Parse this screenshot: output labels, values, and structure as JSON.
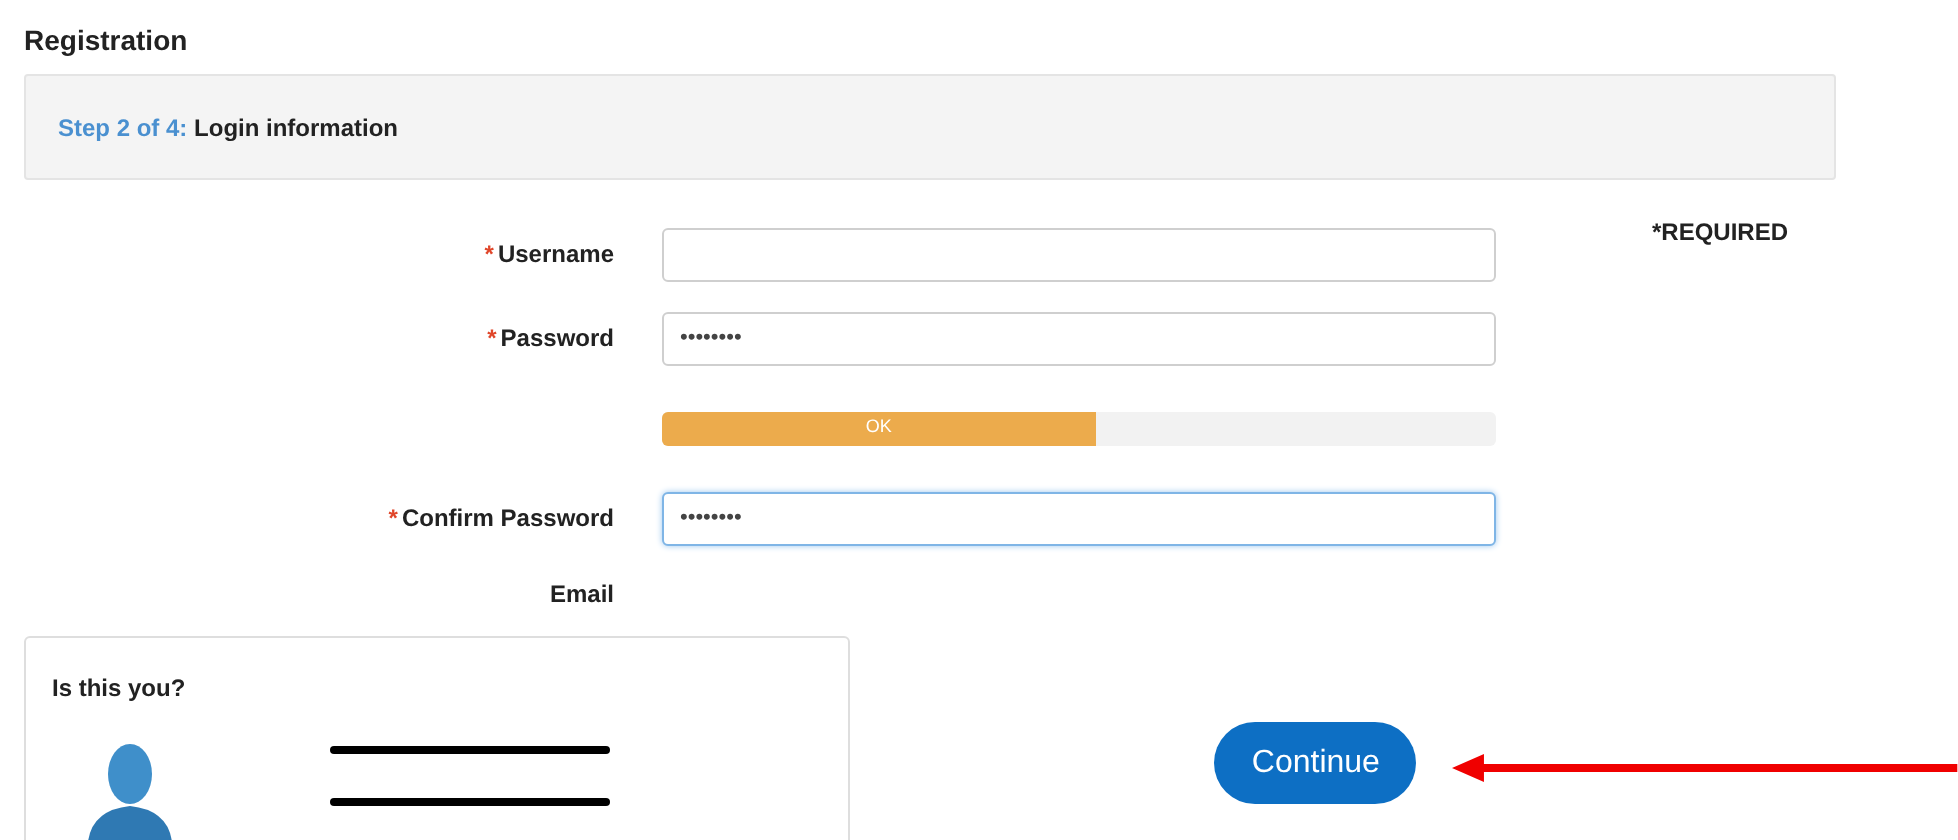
{
  "page_title": "Registration",
  "step": {
    "prefix": "Step 2 of 4:",
    "title": "Login information"
  },
  "required_note": "*REQUIRED",
  "fields": [
    {
      "kind": "input",
      "label": "Username",
      "required": true,
      "focused": false
    },
    {
      "kind": "input",
      "label": "Password",
      "required": true,
      "value": "••••••••",
      "focused": false
    },
    {
      "kind": "meter",
      "level": 0.52,
      "reading": "OK"
    },
    {
      "kind": "input",
      "label": "Confirm Password",
      "required": true,
      "value": "••••••••",
      "focused": true
    },
    {
      "kind": "heading",
      "label": "Email",
      "required": false
    }
  ],
  "required_mark": "*",
  "card": {
    "title": "Is this you?"
  },
  "continue_button": "Continue"
}
